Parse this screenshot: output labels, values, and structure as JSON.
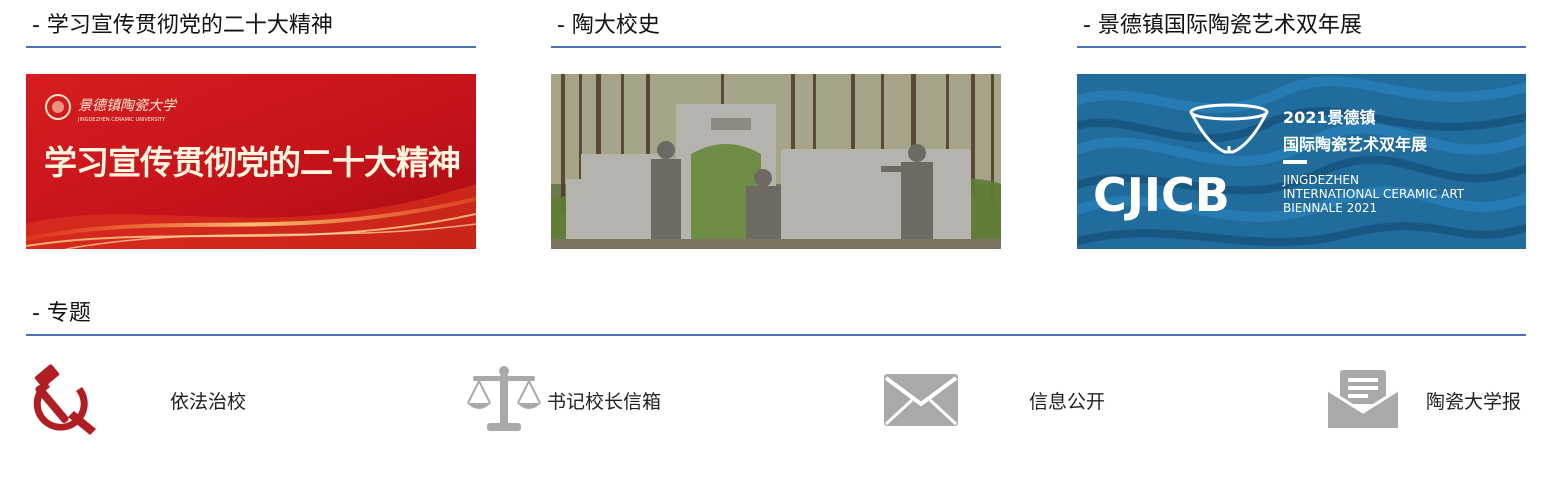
{
  "sections": {
    "party": {
      "title": "- 学习宣传贯彻党的二十大精神"
    },
    "history": {
      "title": "- 陶大校史"
    },
    "biennale": {
      "title": "- 景德镇国际陶瓷艺术双年展"
    },
    "topics": {
      "title": "- 专题"
    }
  },
  "banners": {
    "party": {
      "school_name": "景德镇陶瓷大学",
      "school_name_en": "JINGDEZHEN CERAMIC UNIVERSITY",
      "headline": "学习宣传贯彻党的二十大精神"
    },
    "biennale": {
      "year_title": "2021景德镇",
      "subtitle": "国际陶瓷艺术双年展",
      "logo_text": "CJICB",
      "en_line1": "JINGDEZHEN",
      "en_line2": "INTERNATIONAL CERAMIC ART",
      "en_line3": "BIENNALE 2021"
    }
  },
  "topics": [
    {
      "label": "依法治校",
      "icon": "hammer-sickle-icon"
    },
    {
      "label": "书记校长信箱",
      "icon": "scales-icon"
    },
    {
      "label": "信息公开",
      "icon": "envelope-icon"
    },
    {
      "label": "陶瓷大学报",
      "icon": "newspaper-envelope-icon"
    }
  ],
  "colors": {
    "accent_line": "#4a73b5",
    "party_red": "#c8141a",
    "icon_red": "#b01e23",
    "icon_gray": "#a9a9a9",
    "biennale_blue": "#1f6c9d"
  }
}
